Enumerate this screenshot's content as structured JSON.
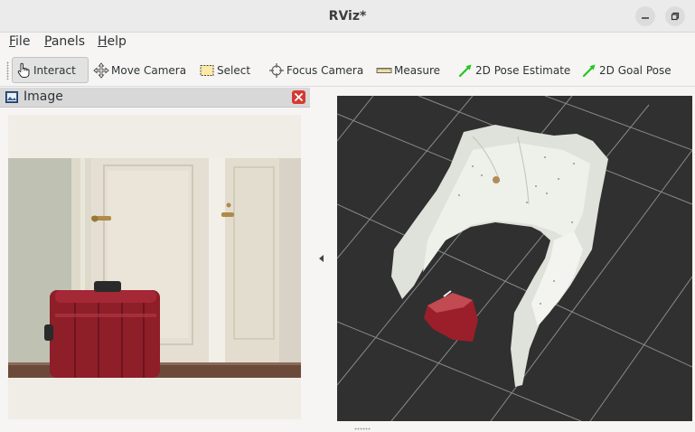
{
  "window": {
    "title": "RViz*"
  },
  "menu": {
    "file": "File",
    "panels": "Panels",
    "help": "Help"
  },
  "toolbar": {
    "interact": "Interact",
    "move_camera": "Move Camera",
    "select": "Select",
    "focus_camera": "Focus Camera",
    "measure": "Measure",
    "pose_estimate": "2D Pose Estimate",
    "goal_pose": "2D Goal Pose",
    "active_tool": "Interact"
  },
  "image_panel": {
    "title": "Image"
  },
  "icons": {
    "minimize": "minimize-icon",
    "maximize": "maximize-icon",
    "interact": "hand-pointer-icon",
    "move_camera": "move-arrows-icon",
    "select": "selection-box-icon",
    "focus_camera": "crosshair-icon",
    "measure": "ruler-icon",
    "pose": "green-arrow-icon",
    "close": "close-icon"
  },
  "colors": {
    "view_background": "#303030",
    "grid_line": "#8a8a8a",
    "pose_arrow": "#1ec81e",
    "close_button": "#d43a32"
  }
}
